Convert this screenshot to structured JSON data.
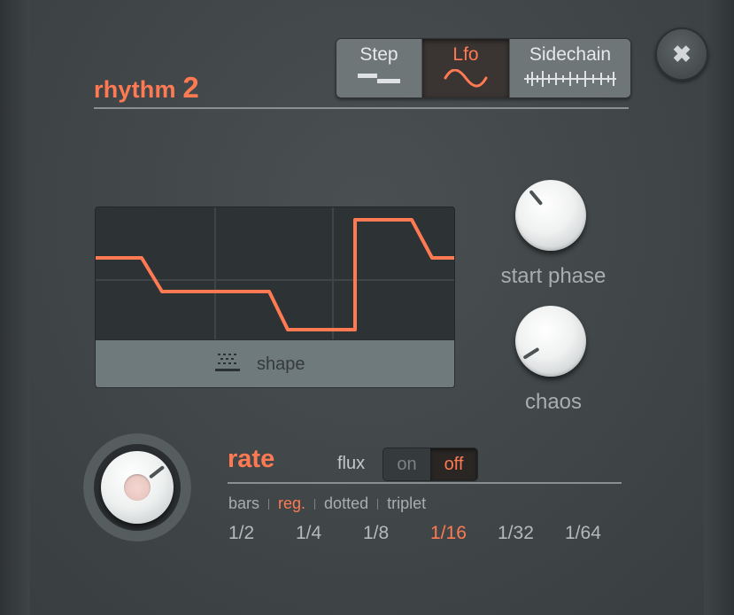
{
  "title": {
    "prefix": "rhythm",
    "number": "2"
  },
  "modes": [
    {
      "label": "Step",
      "icon": "step-icon",
      "active": false
    },
    {
      "label": "Lfo",
      "icon": "sine-wave-icon",
      "active": true
    },
    {
      "label": "Sidechain",
      "icon": "waveform-icon",
      "active": false
    }
  ],
  "close": {
    "glyph": "✖",
    "icon": "close-icon"
  },
  "graph": {
    "shape_label": "shape",
    "shape_icon": "dotted-grid-icon"
  },
  "knobs": {
    "start_phase": {
      "label": "start phase"
    },
    "chaos": {
      "label": "chaos"
    }
  },
  "rate": {
    "title": "rate",
    "flux_label": "flux",
    "flux_on": "on",
    "flux_off": "off",
    "flux_selected": "off",
    "modes": [
      "bars",
      "reg.",
      "dotted",
      "triplet"
    ],
    "mode_selected": "reg.",
    "divisions": [
      "1/2",
      "1/4",
      "1/8",
      "1/16",
      "1/32",
      "1/64"
    ],
    "division_selected": "1/16"
  },
  "colors": {
    "accent": "#ff7a52",
    "background": "#42484a",
    "waveform": "#ff7a52"
  }
}
